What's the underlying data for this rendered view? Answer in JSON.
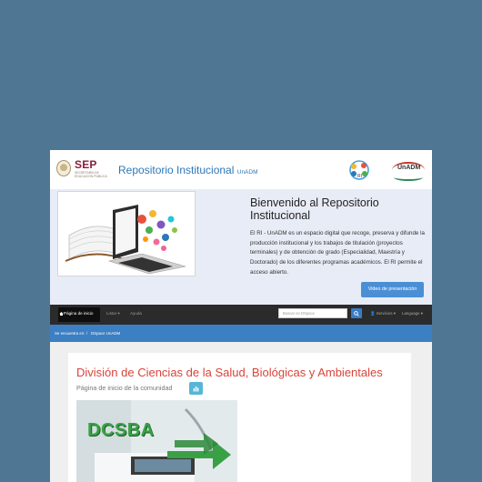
{
  "header": {
    "sep_title": "SEP",
    "sep_subtitle": "SECRETARÍA DE EDUCACIÓN PÚBLICA",
    "repo_title": "Repositorio Institucional",
    "repo_suffix": "UnADM",
    "ri_logo_text": "RI",
    "unadm_logo_text": "UnADM"
  },
  "hero": {
    "title": "Bienvenido al Repositorio Institucional",
    "description": "El RI - UnADM es un espacio digital que recoge, preserva y difunde la producción institucional y los trabajos de titulación (proyectos terminales) y de obtención de grado (Especialidad, Maestría y Doctorado) de los diferentes programas académicos. El RI permite el acceso abierto.",
    "video_button": "Video de presentación"
  },
  "navbar": {
    "home": "Página de inicio",
    "browse": "Listar",
    "help": "Ayuda",
    "search_placeholder": "Buscar en DSpace",
    "services": "Servicios",
    "language": "Language"
  },
  "breadcrumb": {
    "prefix": "Se encuentra en:",
    "item": "DSpace UnADM"
  },
  "community": {
    "title": "División de Ciencias de la Salud, Biológicas y Ambientales",
    "subtitle": "Página de inicio de la comunidad",
    "banner_text": "DCSBA"
  },
  "colors": {
    "page_background": "#4f7794",
    "link_blue": "#2d78b9",
    "community_title": "#d9443a",
    "navbar": "#2b2b2b",
    "breadcrumb_bar": "#3c7fc3",
    "video_button": "#4a8fd6"
  }
}
